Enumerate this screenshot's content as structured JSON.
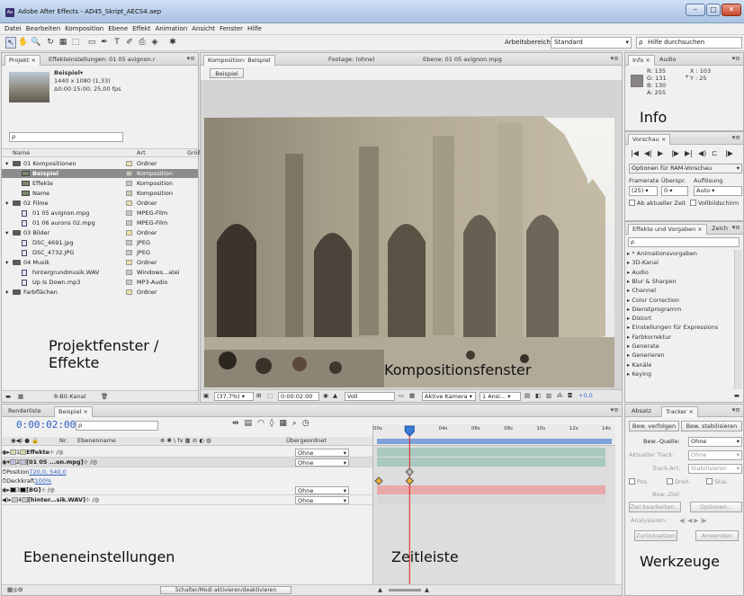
{
  "window": {
    "title": "Adobe After Effects - AD45_Skript_AECS4.aep",
    "app_icon_label": "Ae",
    "minimize_glyph": "–",
    "maximize_glyph": "□",
    "close_glyph": "✕"
  },
  "menu": [
    "Datei",
    "Bearbeiten",
    "Komposition",
    "Ebene",
    "Effekt",
    "Animation",
    "Ansicht",
    "Fenster",
    "Hilfe"
  ],
  "toolbar": {
    "tools": [
      "↖",
      "✋",
      "🔍",
      "↻",
      "▦",
      "⬚",
      "▭",
      "✒",
      "T",
      "✐",
      "⎙",
      "◈",
      "✱"
    ],
    "workspace_label": "Arbeitsbereich:",
    "workspace_value": "Standard",
    "help_placeholder": "Hilfe durchsuchen"
  },
  "project_panel": {
    "tab_project": "Projekt ×",
    "tab_effect_settings": "Effekteinstellungen: 01 05 avignon.r",
    "menu_glyph": "▾≡",
    "item_name": "Beispiel▾",
    "item_size": "1440 x 1080 (1,33)",
    "item_duration": "Δ0:00:15:00, 25,00 fps",
    "search_glyph": "ρ",
    "col_name": "Name",
    "col_type": "Art",
    "col_size": "Größ",
    "rows": [
      {
        "indent": 0,
        "icon": "folder",
        "name": "01 Kompositionen",
        "color": "#e9e0a8",
        "type": "Ordner",
        "selected": false
      },
      {
        "indent": 1,
        "icon": "comp",
        "name": "Beispiel",
        "color": "#c8c8b8",
        "type": "Komposition",
        "selected": true
      },
      {
        "indent": 1,
        "icon": "comp",
        "name": "Effekte",
        "color": "#c8c8b8",
        "type": "Komposition",
        "selected": false
      },
      {
        "indent": 1,
        "icon": "comp",
        "name": "Name",
        "color": "#c8c8b8",
        "type": "Komposition",
        "selected": false
      },
      {
        "indent": 0,
        "icon": "folder",
        "name": "02 Filme",
        "color": "#e9e0a8",
        "type": "Ordner",
        "selected": false
      },
      {
        "indent": 1,
        "icon": "file",
        "name": "01 05 avignon.mpg",
        "color": "#c8c8c8",
        "type": "MPEG-Film",
        "selected": false
      },
      {
        "indent": 1,
        "icon": "file",
        "name": "01 06 aurons 02.mpg",
        "color": "#c8c8c8",
        "type": "MPEG-Film",
        "selected": false
      },
      {
        "indent": 0,
        "icon": "folder",
        "name": "03 Bilder",
        "color": "#e9e0a8",
        "type": "Ordner",
        "selected": false
      },
      {
        "indent": 1,
        "icon": "file",
        "name": "DSC_4691.jpg",
        "color": "#c8c8c8",
        "type": "JPEG",
        "selected": false
      },
      {
        "indent": 1,
        "icon": "file",
        "name": "DSC_4732.JPG",
        "color": "#c8c8c8",
        "type": "JPEG",
        "selected": false
      },
      {
        "indent": 0,
        "icon": "folder",
        "name": "04 Musik",
        "color": "#e9e0a8",
        "type": "Ordner",
        "selected": false
      },
      {
        "indent": 1,
        "icon": "file",
        "name": "hintergrundmusik.WAV",
        "color": "#c8c8c8",
        "type": "Windows...atei",
        "selected": false
      },
      {
        "indent": 1,
        "icon": "file",
        "name": "Up Is Down.mp3",
        "color": "#c8c8c8",
        "type": "MP3-Audio",
        "selected": false
      },
      {
        "indent": 0,
        "icon": "folder",
        "name": "Farbflächen",
        "color": "#e9e0a8",
        "type": "Ordner",
        "selected": false
      }
    ],
    "caption": "Projektfenster /\nEffekte",
    "footer_bpc": "8-Bit-Kanal"
  },
  "comp_panel": {
    "tab_comp": "Komposition: Beispiel",
    "tab_footage": "Footage: (ohne)",
    "tab_layer": "Ebene: 01 05 avignon.mpg",
    "tab_menu": "▾≡",
    "breadcrumb": "Beispiel",
    "caption": "Kompositionsfenster",
    "footer": {
      "zoom": "(37,7%)",
      "timecode": "0:00:02:00",
      "quality": "Voll",
      "camera": "Aktive Kamera",
      "views": "1 Ansi...",
      "exposure": "+0,0"
    }
  },
  "info_panel": {
    "tab_info": "Info ×",
    "tab_audio": "Audio",
    "r": "R:  135",
    "g": "G:  131",
    "b": "B:  130",
    "a": "A:  255",
    "x": "X : 103",
    "y": "Y : 25",
    "swatch_color": "#878382",
    "caption": "Info"
  },
  "preview_panel": {
    "tab": "Vorschau ×",
    "controls": [
      "|◀",
      "◀|",
      "▶",
      "|▶",
      "▶|",
      "◀)",
      "⊏",
      "|▶"
    ],
    "ram_options": "Optionen für RAM-Vorschau",
    "label_framerate": "Framerate",
    "label_skip": "Überspr.",
    "label_resolution": "Auflösung",
    "framerate": "(25)",
    "skip": "0",
    "resolution": "Auto",
    "from_current": "Ab aktueller Zeit",
    "fullscreen": "Vollbildschirm"
  },
  "effects_panel": {
    "tab": "Effekte und Vorgaben ×",
    "tab2": "Zeich",
    "search_glyph": "ρ",
    "items": [
      "* Animationsvorgaben",
      "3D-Kanal",
      "Audio",
      "Blur & Sharpen",
      "Channel",
      "Color Correction",
      "Dienstprogramm",
      "Distort",
      "Einstellungen für Expressions",
      "Farbkorrektur",
      "Generate",
      "Generieren",
      "Kanäle",
      "Keying"
    ]
  },
  "timeline_panel": {
    "tab_render": "Renderliste",
    "tab_comp": "Beispiel ×",
    "timecode": "0:00:02:00",
    "search_glyph": "ρ",
    "col_nr": "Nr.",
    "col_name": "Ebenenname",
    "col_switches": "⊕ ✱ \\ fx ▦ ⊘ ◐ ◍",
    "col_parent": "Übergeordnet",
    "layers": [
      {
        "nr": "1",
        "name": "Effekte",
        "color": "#d8d8a8",
        "parent": "Ohne",
        "bar_color": "#a8c8c0"
      },
      {
        "nr": "2",
        "name": "[01 05 ...on.mpg]",
        "color": "#c0c0e0",
        "parent": "Ohne",
        "bar_color": "#a8c8c0"
      },
      {
        "nr": "3",
        "name": "[BG]",
        "color": "#111111",
        "parent": "Ohne",
        "bar_color": "#e8a8a8"
      },
      {
        "nr": "4",
        "name": "[hinter...sik.WAV]",
        "color": "#c8c8c8",
        "parent": "Ohne",
        "bar_color": "#d8d8d8"
      }
    ],
    "prop_position_label": "Position",
    "prop_position_value": "720,0, 540,0",
    "prop_opacity_label": "Deckkraft",
    "prop_opacity_value": "100%",
    "ruler": [
      "00s",
      "04s",
      "06s",
      "08s",
      "10s",
      "12s",
      "14s"
    ],
    "playhead_time_s": 2,
    "duration_s": 15,
    "keyframes_s": [
      0,
      2
    ],
    "caption_layers": "Ebeneneinstellungen",
    "caption_timeline": "Zeitleiste",
    "footer_toggle": "Schalter/Modi aktivieren/deaktivieren"
  },
  "tracker_panel": {
    "tab_paragraph": "Absatz",
    "tab_tracker": "Tracker ×",
    "btn_track": "Bew. verfolgen",
    "btn_stabilize": "Bew. stabilisieren",
    "label_source": "Bew.-Quelle:",
    "source_value": "Ohne",
    "label_current_track": "Aktueller Track:",
    "current_track_value": "Ohne",
    "label_track_type": "Track-Art:",
    "track_type_value": "Stabilisieren",
    "chk_pos": "Pos.",
    "chk_rot": "Dreh.",
    "chk_scale": "Skal.",
    "label_target": "Bew.-Ziel:",
    "btn_edit_target": "Ziel bearbeiten...",
    "btn_options": "Optionen...",
    "label_analyze": "Analysieren:",
    "analyze_glyphs": "◀|  ◀  ▶  |▶",
    "btn_reset": "Zurücksetzen",
    "btn_apply": "Anwenden",
    "caption": "Werkzeuge"
  }
}
